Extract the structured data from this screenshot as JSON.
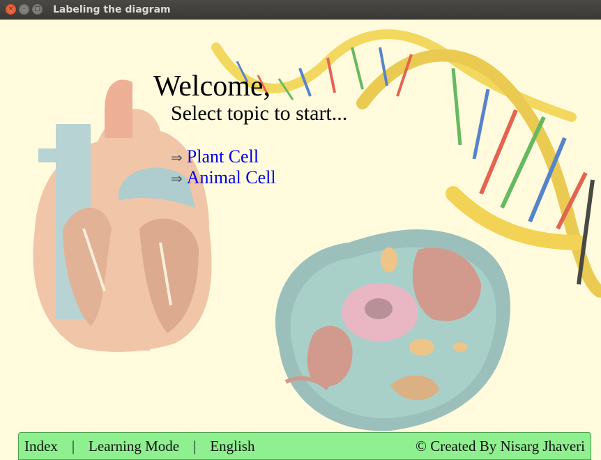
{
  "window": {
    "title": "Labeling the diagram",
    "close_glyph": "×",
    "min_glyph": "–",
    "max_glyph": "□"
  },
  "main": {
    "welcome": "Welcome,",
    "subtitle": "Select topic to start...",
    "arrow_glyph": "⇒",
    "topics": [
      {
        "label": "Plant Cell"
      },
      {
        "label": "Animal Cell"
      }
    ]
  },
  "background_images": [
    "heart-illustration",
    "dna-helix-illustration",
    "animal-cell-illustration"
  ],
  "footer": {
    "index": "Index",
    "separator": "|",
    "learning_mode": "Learning Mode",
    "language": "English",
    "credit": "© Created By Nisarg Jhaveri"
  },
  "colors": {
    "background": "#fffbdc",
    "footer_bg": "#8ef08e",
    "link": "#0000e6"
  }
}
